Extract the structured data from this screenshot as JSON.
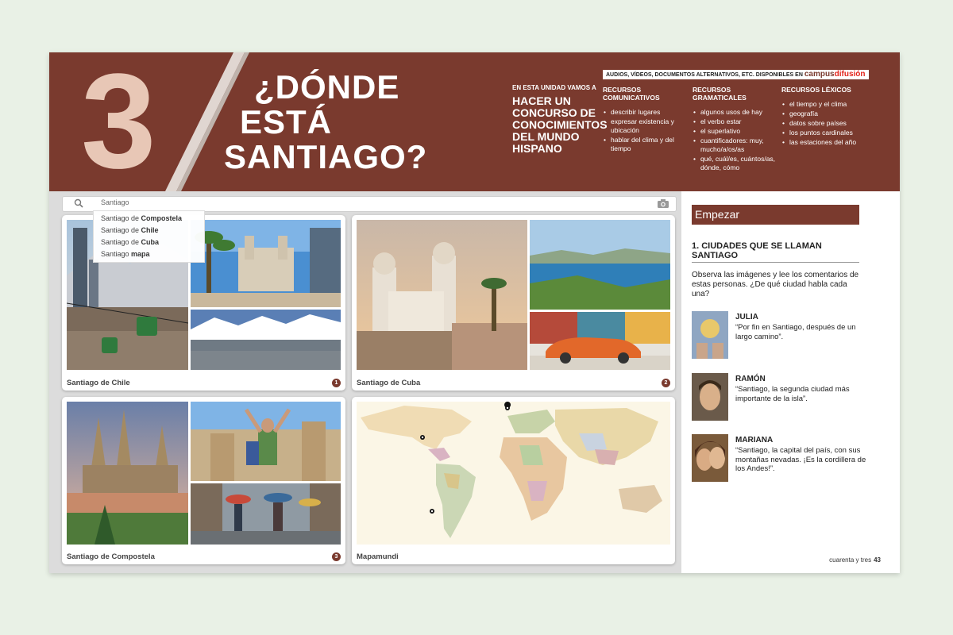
{
  "header": {
    "unit_number": "3",
    "title_line1": "¿DÓNDE",
    "title_line2": "ESTÁ",
    "title_line3": "SANTIAGO?",
    "intro_small": "EN ESTA UNIDAD VAMOS A",
    "intro_big": "HACER UN CONCURSO DE CONOCIMIENTOS DEL MUNDO HISPANO",
    "campus_text": "AUDIOS, VÍDEOS, DOCUMENTOS ALTERNATIVOS, ETC. DISPONIBLES EN",
    "campus_brand1": "campus",
    "campus_brand2": "difusión",
    "columns": [
      {
        "heading": "RECURSOS COMUNICATIVOS",
        "items": [
          "describir lugares",
          "expresar existencia y ubicación",
          "hablar del clima y del tiempo"
        ]
      },
      {
        "heading": "RECURSOS GRAMATICALES",
        "items": [
          "algunos usos de hay",
          "el verbo estar",
          "el superlativo",
          "cuantificadores: muy, mucho/a/os/as",
          "qué, cuál/es, cuántos/as, dónde, cómo"
        ]
      },
      {
        "heading": "RECURSOS LÉXICOS",
        "items": [
          "el tiempo y el clima",
          "geografía",
          "datos sobre países",
          "los puntos cardinales",
          "las estaciones del año"
        ]
      }
    ]
  },
  "search": {
    "value": "Santiago",
    "suggestions": [
      "Santiago de Compostela",
      "Santiago de Chile",
      "Santiago de Cuba",
      "Santiago mapa"
    ]
  },
  "panels": [
    {
      "caption": "Santiago de Chile",
      "number": "1"
    },
    {
      "caption": "Santiago de Cuba",
      "number": "2"
    },
    {
      "caption": "Santiago de Compostela",
      "number": "3"
    },
    {
      "caption": "Mapamundi",
      "number": ""
    }
  ],
  "right": {
    "section": "Empezar",
    "exercise_title": "1. CIUDADES QUE SE LLAMAN SANTIAGO",
    "instruction": "Observa las imágenes y lee los comentarios de estas personas. ¿De qué ciudad habla cada una?",
    "people": [
      {
        "name": "JULIA",
        "quote": "“Por fin en Santiago, después de un largo camino”."
      },
      {
        "name": "RAMÓN",
        "quote": "“Santiago, la segunda ciudad más importante de la isla”."
      },
      {
        "name": "MARIANA",
        "quote": "“Santiago, la capital del país, con sus montañas nevadas. ¡Es la cordillera de los Andes!”."
      }
    ]
  },
  "footer": {
    "page_text": "cuarenta y tres",
    "page_num": "43"
  },
  "colors": {
    "brown": "#7a3a2e",
    "accent_red": "#e2231a"
  }
}
